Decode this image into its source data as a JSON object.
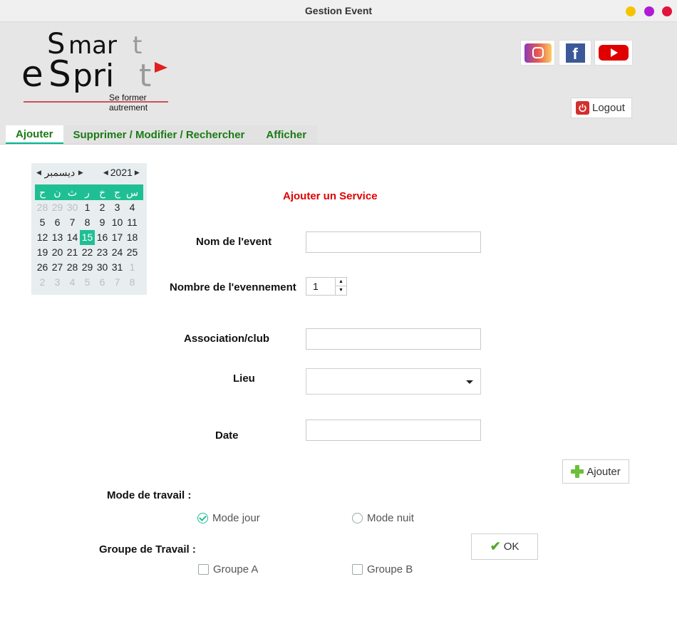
{
  "window": {
    "title": "Gestion Event",
    "dot_colors": [
      "#f5c400",
      "#b01bd6",
      "#e0143c"
    ]
  },
  "logo": {
    "main_text": "Smart eSprit",
    "tagline": "Se former autrement"
  },
  "header": {
    "logout_label": "Logout",
    "social": [
      "instagram-icon",
      "facebook-icon",
      "youtube-icon"
    ]
  },
  "tabs": [
    "Ajouter",
    "Supprimer / Modifier / Rechercher",
    "Afficher"
  ],
  "calendar": {
    "month": "ديسمبر",
    "year": "2021",
    "weekdays": [
      "ح",
      "ن",
      "ث",
      "ر",
      "خ",
      "ج",
      "س"
    ],
    "days": [
      [
        "28",
        "29",
        "30",
        "1",
        "2",
        "3",
        "4"
      ],
      [
        "5",
        "6",
        "7",
        "8",
        "9",
        "10",
        "11"
      ],
      [
        "12",
        "13",
        "14",
        "15",
        "16",
        "17",
        "18"
      ],
      [
        "19",
        "20",
        "21",
        "22",
        "23",
        "24",
        "25"
      ],
      [
        "26",
        "27",
        "28",
        "29",
        "30",
        "31",
        "1"
      ],
      [
        "2",
        "3",
        "4",
        "5",
        "6",
        "7",
        "8"
      ]
    ],
    "selected_day": "15"
  },
  "form": {
    "section_title": "Ajouter un Service",
    "nom_label": "Nom de l'event",
    "nom_value": "",
    "nombre_label": "Nombre de l'evennement",
    "nombre_value": "1",
    "association_label": "Association/club",
    "association_value": "",
    "lieu_label": "Lieu",
    "lieu_value": "",
    "date_label": "Date",
    "date_value": "",
    "ajouter_label": "Ajouter",
    "mode_label": "Mode de travail  :",
    "mode_jour": "Mode jour",
    "mode_nuit": "Mode nuit",
    "groupe_label": "Groupe de Travail  :",
    "groupe_a": "Groupe A",
    "groupe_b": "Groupe B",
    "ok_label": "OK"
  }
}
